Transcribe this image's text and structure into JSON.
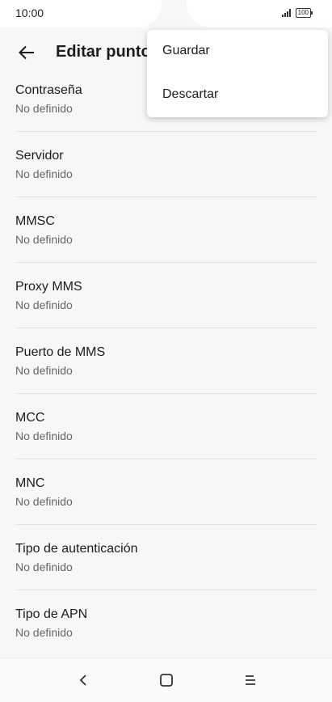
{
  "status_bar": {
    "time": "10:00",
    "battery_level": "100",
    "icons": [
      "signal-icon",
      "battery-icon"
    ]
  },
  "app_bar": {
    "back_icon": "back-arrow-icon",
    "title": "Editar punto"
  },
  "menu": {
    "items": [
      {
        "label": "Guardar"
      },
      {
        "label": "Descartar"
      }
    ]
  },
  "preferences": [
    {
      "title": "Contraseña",
      "summary": "No definido"
    },
    {
      "title": "Servidor",
      "summary": "No definido"
    },
    {
      "title": "MMSC",
      "summary": "No definido"
    },
    {
      "title": "Proxy MMS",
      "summary": "No definido"
    },
    {
      "title": "Puerto de MMS",
      "summary": "No definido"
    },
    {
      "title": "MCC",
      "summary": "No definido"
    },
    {
      "title": "MNC",
      "summary": "No definido"
    },
    {
      "title": "Tipo de autenticación",
      "summary": "No definido"
    },
    {
      "title": "Tipo de APN",
      "summary": "No definido"
    }
  ],
  "nav_bar": {
    "icons": [
      "back-icon",
      "home-icon",
      "menu-icon"
    ]
  }
}
